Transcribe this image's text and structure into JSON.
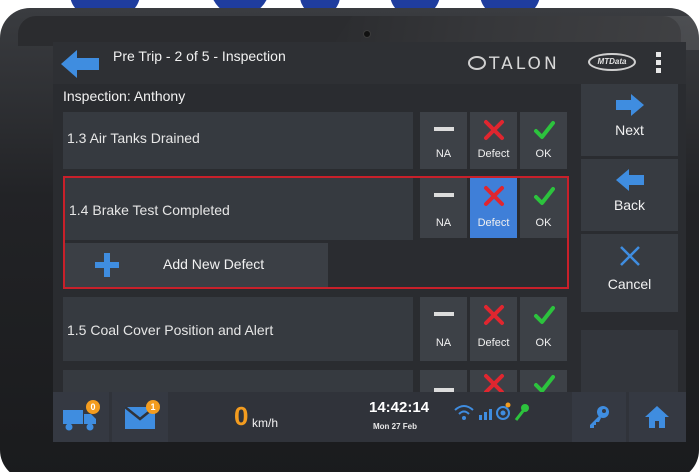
{
  "header": {
    "title": "Pre Trip - 2 of 5 - Inspection",
    "brand": "TALON",
    "partner_logo": "MTData",
    "back_icon": "back-arrow-icon",
    "menu_icon": "kebab-menu-icon"
  },
  "subheader": "Inspection: Anthony",
  "rows": [
    {
      "label": "1.3 Air Tanks Drained",
      "selected": null
    },
    {
      "label": "1.4 Brake Test Completed",
      "selected": "Defect"
    },
    {
      "label": "1.5 Coal Cover Position and Alert",
      "selected": null
    }
  ],
  "buttons": {
    "na": "NA",
    "defect": "Defect",
    "ok": "OK"
  },
  "add_defect_label": "Add New Defect",
  "side_nav": {
    "next": "Next",
    "back": "Back",
    "cancel": "Cancel"
  },
  "status_bar": {
    "truck_badge": "0",
    "mail_badge": "1",
    "speed": "0",
    "speed_unit": "km/h",
    "time": "14:42:14",
    "date": "Mon 27 Feb"
  },
  "colors": {
    "accent_blue": "#3f7fd8",
    "defect_red": "#e0262f",
    "ok_green": "#2cc33d",
    "badge_orange": "#f39c1f",
    "selection_border": "#c8202a"
  }
}
